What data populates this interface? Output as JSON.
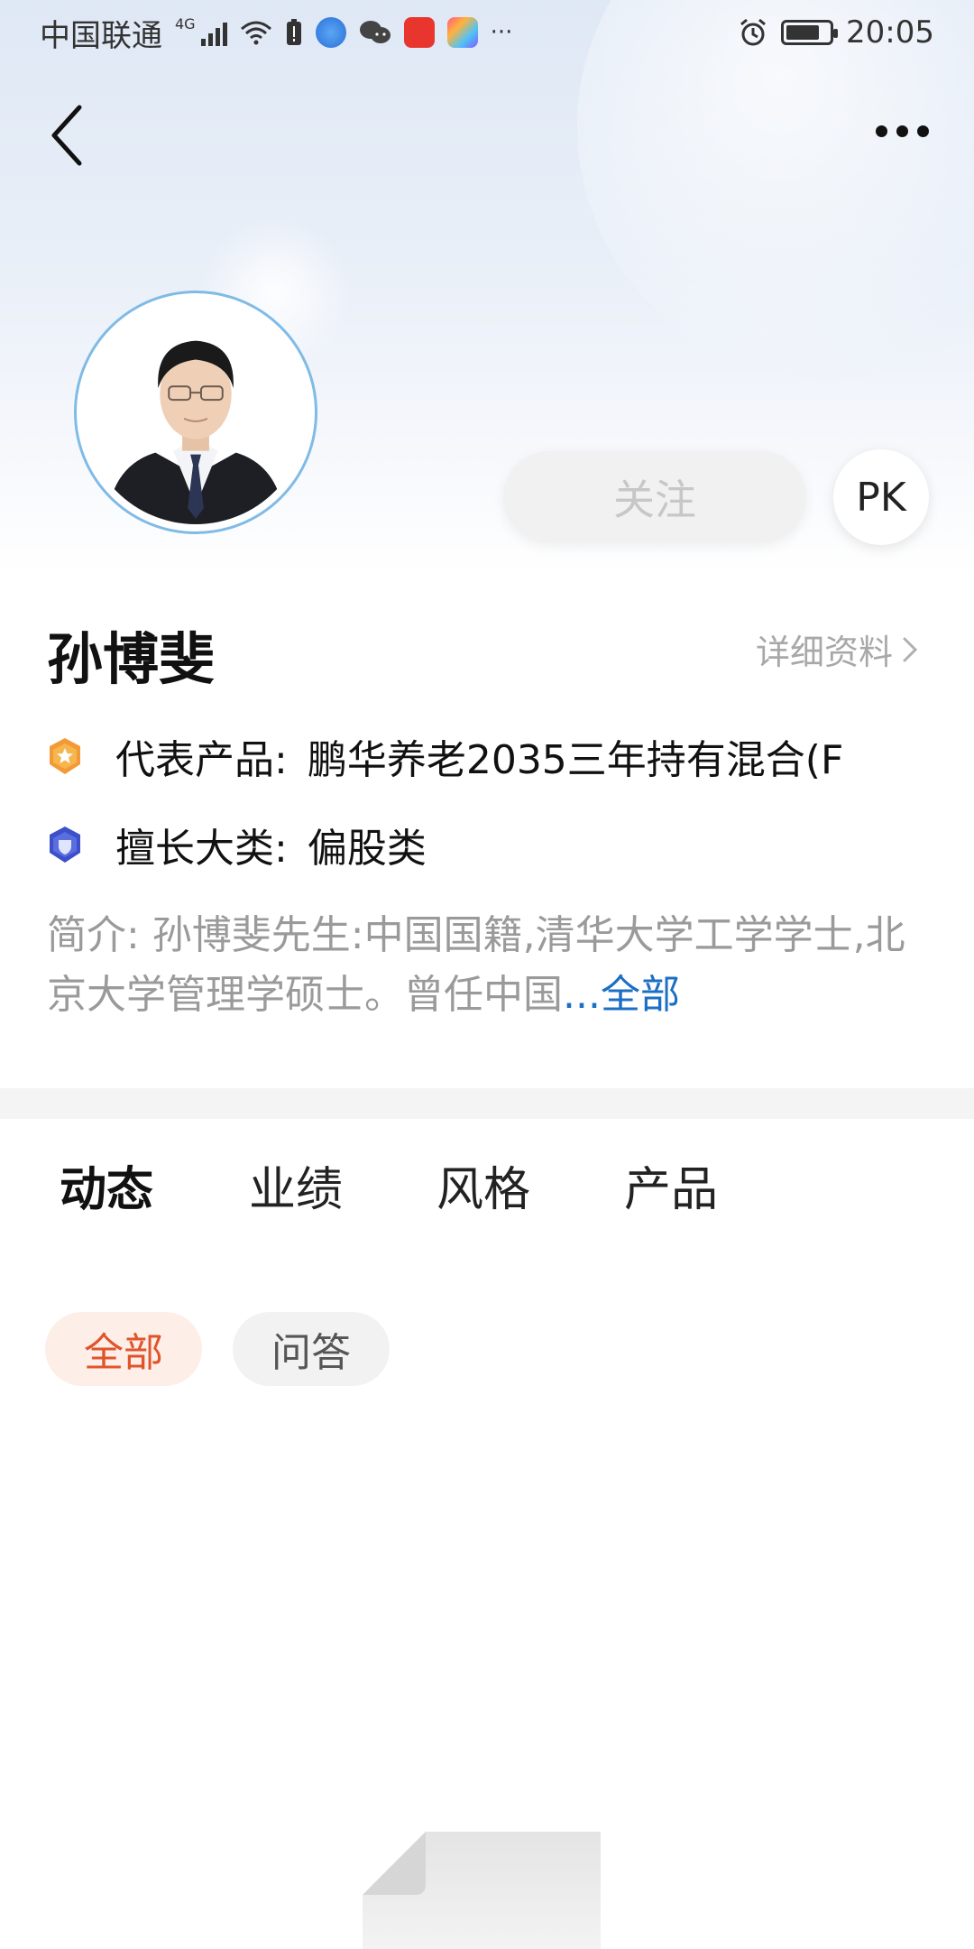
{
  "status_bar": {
    "carrier": "中国联通",
    "network": "4G",
    "time": "20:05",
    "overflow": "···"
  },
  "header": {
    "back_icon": "chevron-left-icon",
    "more_icon": "more-dots-icon"
  },
  "profile": {
    "follow_label": "关注",
    "pk_label": "PK",
    "name": "孙博斐",
    "detail_link": "详细资料",
    "product_label": "代表产品:",
    "product_value": "鹏华养老2035三年持有混合(F",
    "category_label": "擅长大类:",
    "category_value": "偏股类",
    "intro_text": "简介:  孙博斐先生:中国国籍,清华大学工学学士,北京大学管理学硕士。曾任中国",
    "intro_more": "...全部"
  },
  "tabs": [
    {
      "label": "动态",
      "active": true
    },
    {
      "label": "业绩",
      "active": false
    },
    {
      "label": "风格",
      "active": false
    },
    {
      "label": "产品",
      "active": false
    }
  ],
  "filters": [
    {
      "label": "全部",
      "active": true
    },
    {
      "label": "问答",
      "active": false
    }
  ],
  "colors": {
    "accent_blue": "#1b6fc4",
    "chip_active_text": "#e0542b",
    "chip_active_bg": "#fdeee8",
    "badge_orange": "#f29a38",
    "badge_blue": "#4f63d8"
  }
}
